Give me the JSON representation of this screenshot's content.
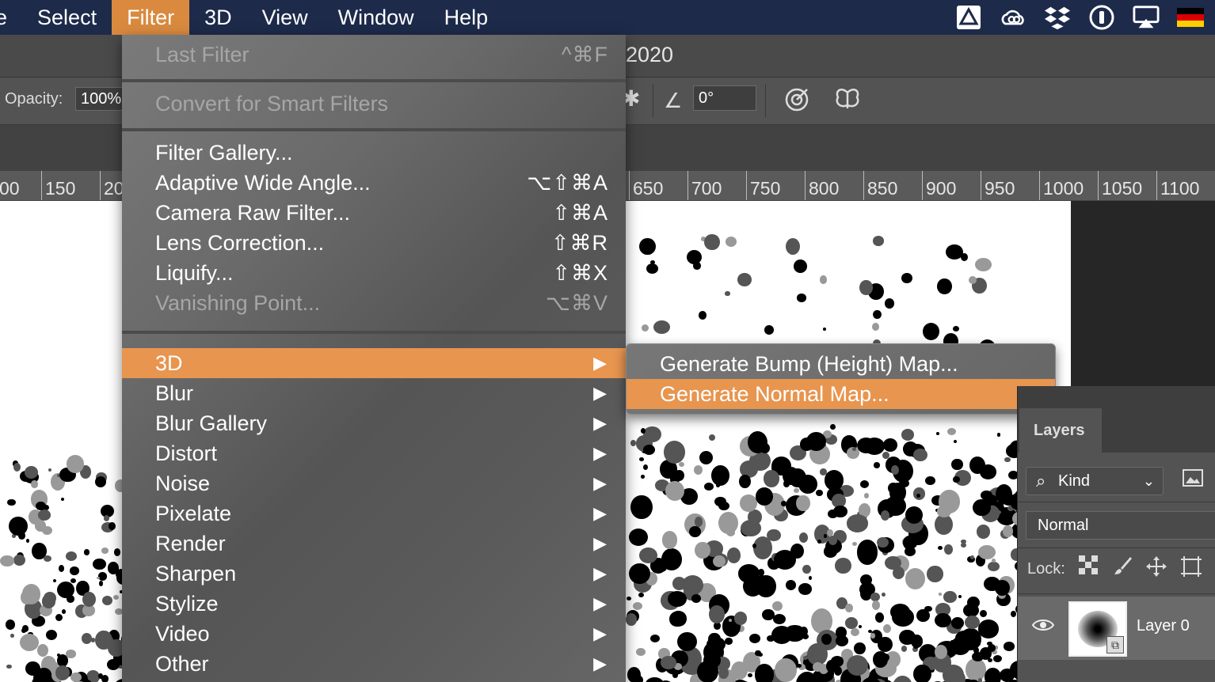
{
  "menubar": {
    "items": [
      {
        "label": "e"
      },
      {
        "label": "Select"
      },
      {
        "label": "Filter"
      },
      {
        "label": "3D"
      },
      {
        "label": "View"
      },
      {
        "label": "Window"
      },
      {
        "label": "Help"
      }
    ],
    "status_icons": [
      "google-drive-icon",
      "creative-cloud-icon",
      "dropbox-icon",
      "1password-icon",
      "airplay-icon",
      "german-flag-icon"
    ]
  },
  "document": {
    "title_partial": "2020"
  },
  "options": {
    "opacity_label": "Opacity:",
    "opacity_value": "100%",
    "angle_value": "0°"
  },
  "ruler": {
    "ticks": [
      "00",
      "150",
      "20",
      "650",
      "700",
      "750",
      "800",
      "850",
      "900",
      "950",
      "1000",
      "1050",
      "1100"
    ]
  },
  "filter_menu": {
    "last_filter": {
      "label": "Last Filter",
      "shortcut": "^⌘F"
    },
    "convert_smart": {
      "label": "Convert for Smart Filters"
    },
    "filter_gallery": {
      "label": "Filter Gallery..."
    },
    "adaptive_wide_angle": {
      "label": "Adaptive Wide Angle...",
      "shortcut": "⌥⇧⌘A"
    },
    "camera_raw": {
      "label": "Camera Raw Filter...",
      "shortcut": "⇧⌘A"
    },
    "lens_correction": {
      "label": "Lens Correction...",
      "shortcut": "⇧⌘R"
    },
    "liquify": {
      "label": "Liquify...",
      "shortcut": "⇧⌘X"
    },
    "vanishing_point": {
      "label": "Vanishing Point...",
      "shortcut": "⌥⌘V"
    },
    "submenus": [
      {
        "label": "3D"
      },
      {
        "label": "Blur"
      },
      {
        "label": "Blur Gallery"
      },
      {
        "label": "Distort"
      },
      {
        "label": "Noise"
      },
      {
        "label": "Pixelate"
      },
      {
        "label": "Render"
      },
      {
        "label": "Sharpen"
      },
      {
        "label": "Stylize"
      },
      {
        "label": "Video"
      },
      {
        "label": "Other"
      }
    ],
    "arrow_glyph": "▶"
  },
  "submenu_3d": {
    "items": [
      {
        "label": "Generate Bump (Height) Map..."
      },
      {
        "label": "Generate Normal Map..."
      }
    ]
  },
  "layers_panel": {
    "tab_label": "Layers",
    "kind_label": "Kind",
    "blend_mode": "Normal",
    "lock_label": "Lock:",
    "layer_name": "Layer 0"
  },
  "colors": {
    "menubar_bg": "#1d2a4a",
    "highlight": "#e7954f",
    "active_menu": "#d98a3f"
  }
}
